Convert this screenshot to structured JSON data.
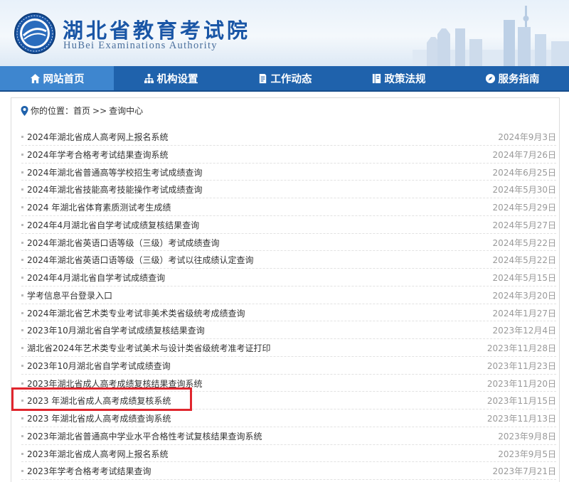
{
  "header": {
    "title": "湖北省教育考试院",
    "subtitle": "HuBei Examinations Authority"
  },
  "nav": {
    "items": [
      {
        "label": "网站首页",
        "icon": "home-icon"
      },
      {
        "label": "机构设置",
        "icon": "org-chart-icon"
      },
      {
        "label": "工作动态",
        "icon": "document-icon"
      },
      {
        "label": "政策法规",
        "icon": "policy-icon"
      },
      {
        "label": "服务指南",
        "icon": "compass-icon"
      }
    ],
    "active_index": 0
  },
  "breadcrumb": {
    "prefix": "你的位置：",
    "home": "首页",
    "separator": ">>",
    "current": "查询中心"
  },
  "list": [
    {
      "title": "2024年湖北省成人高考网上报名系统",
      "date": "2024年9月3日"
    },
    {
      "title": "2024年学考合格考考试结果查询系统",
      "date": "2024年7月26日"
    },
    {
      "title": "2024年湖北省普通高等学校招生考试成绩查询",
      "date": "2024年6月25日"
    },
    {
      "title": "2024年湖北省技能高考技能操作考试成绩查询",
      "date": "2024年5月30日"
    },
    {
      "title": "2024 年湖北省体育素质测试考生成绩",
      "date": "2024年5月29日"
    },
    {
      "title": "2024年4月湖北省自学考试成绩复核结果查询",
      "date": "2024年5月27日"
    },
    {
      "title": "2024年湖北省英语口语等级（三级）考试成绩查询",
      "date": "2024年5月22日"
    },
    {
      "title": "2024年湖北省英语口语等级（三级）考试以往成绩认定查询",
      "date": "2024年5月22日"
    },
    {
      "title": "2024年4月湖北省自学考试成绩查询",
      "date": "2024年5月15日"
    },
    {
      "title": "学考信息平台登录入口",
      "date": "2024年3月20日"
    },
    {
      "title": "2024年湖北省艺术类专业考试非美术类省级统考成绩查询",
      "date": "2024年1月27日"
    },
    {
      "title": "2023年10月湖北省自学考试成绩复核结果查询",
      "date": "2023年12月4日"
    },
    {
      "title": "湖北省2024年艺术类专业考试美术与设计类省级统考准考证打印",
      "date": "2023年11月28日"
    },
    {
      "title": "2023年10月湖北省自学考试成绩查询",
      "date": "2023年11月23日"
    },
    {
      "title": "2023年湖北省成人高考成绩复核结果查询系统",
      "date": "2023年11月20日"
    },
    {
      "title": "2023 年湖北省成人高考成绩复核系统",
      "date": "2023年11月15日"
    },
    {
      "title": "2023 年湖北省成人高考成绩查询系统",
      "date": "2023年11月13日"
    },
    {
      "title": "2023年湖北省普通高中学业水平合格性考试复核结果查询系统",
      "date": "2023年9月8日"
    },
    {
      "title": "2023年湖北省成人高考网上报名系统",
      "date": "2023年9月5日"
    },
    {
      "title": "2023年学考合格考考试结果查询",
      "date": "2023年7月21日"
    }
  ],
  "highlighted_index": 15,
  "colors": {
    "nav_bg": "#1f62ac",
    "nav_active": "#3e86cf",
    "title_blue": "#1a56a6",
    "highlight_red": "#e0262e"
  }
}
